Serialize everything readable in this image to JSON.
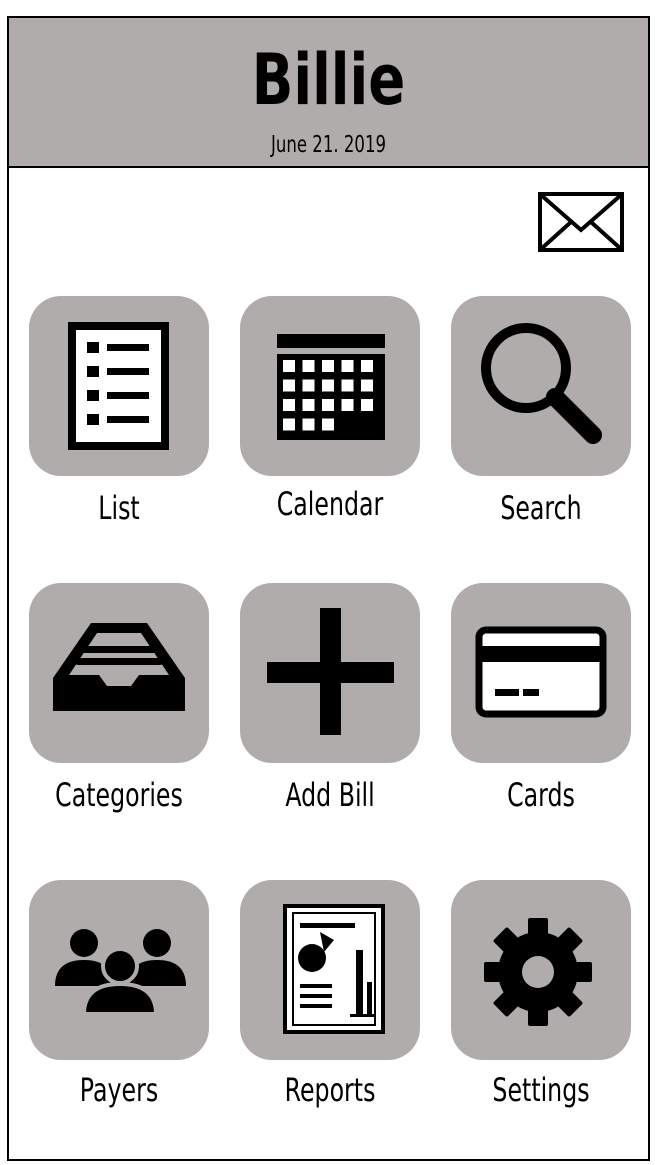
{
  "header": {
    "title": "Billie",
    "date": "June 21. 2019",
    "background_color": "#b0acab"
  },
  "mail_icon": "envelope-icon",
  "tiles": [
    {
      "label": "List",
      "icon": "list-icon"
    },
    {
      "label": "Calendar",
      "icon": "calendar-icon"
    },
    {
      "label": "Search",
      "icon": "search-icon"
    },
    {
      "label": "Categories",
      "icon": "inbox-tray-icon"
    },
    {
      "label": "Add Bill",
      "icon": "plus-icon"
    },
    {
      "label": "Cards",
      "icon": "credit-card-icon"
    },
    {
      "label": "Payers",
      "icon": "people-group-icon"
    },
    {
      "label": "Reports",
      "icon": "report-document-icon"
    },
    {
      "label": "Settings",
      "icon": "gear-icon"
    }
  ],
  "tile_color": "#b0acab"
}
